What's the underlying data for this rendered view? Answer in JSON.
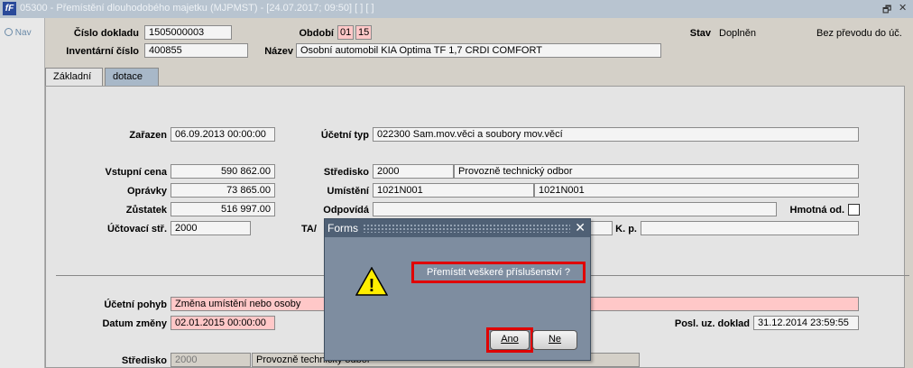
{
  "window": {
    "title": "05300 - Přemístění dlouhodobého majetku (MJPMST) - [24.07.2017; 09:50]  [ ]  [ ]",
    "app_icon": "fF",
    "restore_glyph": "🗗",
    "close_glyph": "✕"
  },
  "sidebar": {
    "nav_label": "Nav"
  },
  "header": {
    "cislo_dokladu_label": "Číslo dokladu",
    "cislo_dokladu_value": "1505000003",
    "inventarni_cislo_label": "Inventární číslo",
    "inventarni_cislo_value": "400855",
    "obdobi_label": "Období",
    "obdobi_month": "01",
    "obdobi_year": "15",
    "nazev_label": "Název",
    "nazev_value": "Osobní automobil KIA Optima TF 1,7 CRDI COMFORT",
    "stav_label": "Stav",
    "stav_value": "Doplněn",
    "prevod_text": "Bez převodu do úč."
  },
  "tabs": [
    {
      "label": "Základní",
      "active": true
    },
    {
      "label": "dotace",
      "active": false
    }
  ],
  "form": {
    "zarazen_label": "Zařazen",
    "zarazen_value": "06.09.2013 00:00:00",
    "ucetni_typ_label": "Účetní typ",
    "ucetni_typ_value": "022300 Sam.mov.věci a soubory mov.věcí",
    "vstupni_cena_label": "Vstupní cena",
    "vstupni_cena_value": "590 862.00",
    "opravky_label": "Oprávky",
    "opravky_value": "73 865.00",
    "zustatek_label": "Zůstatek",
    "zustatek_value": "516 997.00",
    "uctovaci_str_label": "Účtovací stř.",
    "uctovaci_str_value": "2000",
    "stredisko_label": "Středisko",
    "stredisko_code": "2000",
    "stredisko_name": "Provozně technický odbor",
    "umisteni_label": "Umístění",
    "umisteni_code": "1021N001",
    "umisteni_name": "1021N001",
    "odpovida_label": "Odpovídá",
    "odpovida_value": "",
    "hmotna_label": "Hmotná od.",
    "ta_label": "TA/",
    "kp_label": "K. p.",
    "kp_value": ""
  },
  "lower": {
    "ucetni_pohyb_label": "Účetní pohyb",
    "ucetni_pohyb_value": "Změna umístění nebo osoby",
    "datum_zmeny_label": "Datum změny",
    "datum_zmeny_value": "02.01.2015 00:00:00",
    "posl_doklad_label": "Posl. uz. doklad",
    "posl_doklad_value": "31.12.2014 23:59:55",
    "stredisko2_label": "Středisko",
    "stredisko2_code": "2000",
    "stredisko2_name": "Provozně technický odbor"
  },
  "dialog": {
    "title": "Forms",
    "message": "Přemístit veškeré příslušenství ?",
    "yes_label": "Ano",
    "no_label": "Ne",
    "warning_glyph": "!"
  },
  "colors": {
    "highlight": "#e00000",
    "required_field": "#ffc8c8",
    "dialog_bg": "#7e8da0"
  }
}
